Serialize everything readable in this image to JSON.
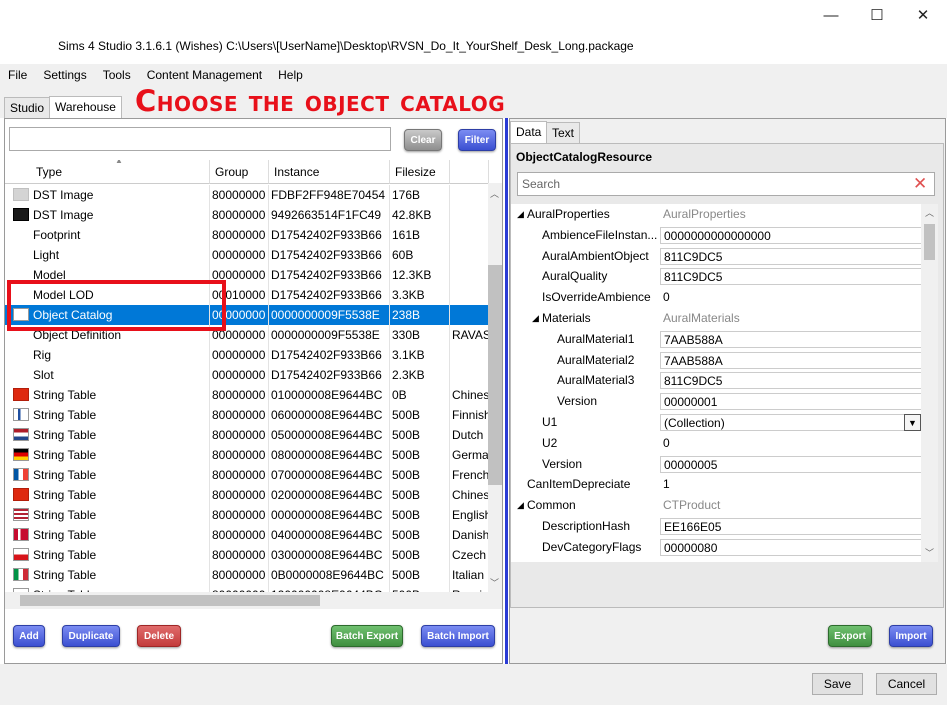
{
  "window": {
    "title": "Sims 4 Studio 3.1.6.1 (Wishes)  C:\\Users\\[UserName]\\Desktop\\RVSN_Do_It_YourShelf_Desk_Long.package",
    "minimize": "—",
    "maximize": "☐",
    "close": "✕"
  },
  "menu": [
    "File",
    "Settings",
    "Tools",
    "Content Management",
    "Help"
  ],
  "tabs": {
    "studio": "Studio",
    "warehouse": "Warehouse"
  },
  "headline": "Choose the object catalog",
  "toolbar": {
    "clear": "Clear",
    "filter": "Filter",
    "filter_value": ""
  },
  "grid": {
    "columns": [
      "Type",
      "Group",
      "Instance",
      "Filesize",
      ""
    ],
    "rows": [
      {
        "type": "DST Image",
        "group": "80000000",
        "instance": "FDBF2FF948E70454",
        "size": "176B",
        "extra": "",
        "icon": "gray"
      },
      {
        "type": "DST Image",
        "group": "80000000",
        "instance": "9492663514F1FC49",
        "size": "42.8KB",
        "extra": "",
        "icon": "dark"
      },
      {
        "type": "Footprint",
        "group": "80000000",
        "instance": "D17542402F933B66",
        "size": "161B",
        "extra": "",
        "icon": ""
      },
      {
        "type": "Light",
        "group": "00000000",
        "instance": "D17542402F933B66",
        "size": "60B",
        "extra": "",
        "icon": ""
      },
      {
        "type": "Model",
        "group": "00000000",
        "instance": "D17542402F933B66",
        "size": "12.3KB",
        "extra": "",
        "icon": ""
      },
      {
        "type": "Model LOD",
        "group": "00010000",
        "instance": "D17542402F933B66",
        "size": "3.3KB",
        "extra": "",
        "icon": ""
      },
      {
        "type": "Object Catalog",
        "group": "00000000",
        "instance": "0000000009F5538E",
        "size": "238B",
        "extra": "",
        "icon": "white",
        "selected": true
      },
      {
        "type": "Object Definition",
        "group": "00000000",
        "instance": "0000000009F5538E",
        "size": "330B",
        "extra": "RAVAS",
        "icon": ""
      },
      {
        "type": "Rig",
        "group": "00000000",
        "instance": "D17542402F933B66",
        "size": "3.1KB",
        "extra": "",
        "icon": ""
      },
      {
        "type": "Slot",
        "group": "00000000",
        "instance": "D17542402F933B66",
        "size": "2.3KB",
        "extra": "",
        "icon": ""
      },
      {
        "type": "String Table",
        "group": "80000000",
        "instance": "010000008E9644BC",
        "size": "0B",
        "extra": "Chines",
        "icon": "cn"
      },
      {
        "type": "String Table",
        "group": "80000000",
        "instance": "060000008E9644BC",
        "size": "500B",
        "extra": "Finnish",
        "icon": "fi"
      },
      {
        "type": "String Table",
        "group": "80000000",
        "instance": "050000008E9644BC",
        "size": "500B",
        "extra": "Dutch",
        "icon": "nl"
      },
      {
        "type": "String Table",
        "group": "80000000",
        "instance": "080000008E9644BC",
        "size": "500B",
        "extra": "Germa",
        "icon": "de"
      },
      {
        "type": "String Table",
        "group": "80000000",
        "instance": "070000008E9644BC",
        "size": "500B",
        "extra": "French",
        "icon": "fr"
      },
      {
        "type": "String Table",
        "group": "80000000",
        "instance": "020000008E9644BC",
        "size": "500B",
        "extra": "Chines",
        "icon": "cn"
      },
      {
        "type": "String Table",
        "group": "80000000",
        "instance": "000000008E9644BC",
        "size": "500B",
        "extra": "English",
        "icon": "us"
      },
      {
        "type": "String Table",
        "group": "80000000",
        "instance": "040000008E9644BC",
        "size": "500B",
        "extra": "Danish",
        "icon": "dk"
      },
      {
        "type": "String Table",
        "group": "80000000",
        "instance": "030000008E9644BC",
        "size": "500B",
        "extra": "Czech",
        "icon": "cz"
      },
      {
        "type": "String Table",
        "group": "80000000",
        "instance": "0B0000008E9644BC",
        "size": "500B",
        "extra": "Italian",
        "icon": "it"
      },
      {
        "type": "String Table",
        "group": "80000000",
        "instance": "120000008E9644BC",
        "size": "500B",
        "extra": "Russia",
        "icon": "ru"
      }
    ]
  },
  "left_buttons": {
    "add": "Add",
    "duplicate": "Duplicate",
    "delete": "Delete",
    "batch_export": "Batch Export",
    "batch_import": "Batch Import"
  },
  "right_tabs": {
    "data": "Data",
    "text": "Text"
  },
  "resource_title": "ObjectCatalogResource",
  "search_placeholder": "Search",
  "properties": [
    {
      "name": "AuralProperties",
      "value": "AuralProperties",
      "level": 0,
      "expander": true,
      "category": true
    },
    {
      "name": "AmbienceFileInstan...",
      "value": "0000000000000000",
      "level": 1
    },
    {
      "name": "AuralAmbientObject",
      "value": "811C9DC5",
      "level": 1
    },
    {
      "name": "AuralQuality",
      "value": "811C9DC5",
      "level": 1
    },
    {
      "name": "IsOverrideAmbience",
      "value": "0",
      "level": 1,
      "plain": true
    },
    {
      "name": "Materials",
      "value": "AuralMaterials",
      "level": 1,
      "expander": true,
      "category": true
    },
    {
      "name": "AuralMaterial1",
      "value": "7AAB588A",
      "level": 2
    },
    {
      "name": "AuralMaterial2",
      "value": "7AAB588A",
      "level": 2
    },
    {
      "name": "AuralMaterial3",
      "value": "811C9DC5",
      "level": 2
    },
    {
      "name": "Version",
      "value": "00000001",
      "level": 2
    },
    {
      "name": "U1",
      "value": "(Collection)",
      "level": 1,
      "dropdown": true
    },
    {
      "name": "U2",
      "value": "0",
      "level": 1,
      "plain": true
    },
    {
      "name": "Version",
      "value": "00000005",
      "level": 1
    },
    {
      "name": "CanItemDepreciate",
      "value": "1",
      "level": 0,
      "plain": true
    },
    {
      "name": "Common",
      "value": "CTProduct",
      "level": 0,
      "expander": true,
      "category": true
    },
    {
      "name": "DescriptionHash",
      "value": "EE166E05",
      "level": 1
    },
    {
      "name": "DevCategoryFlags",
      "value": "00000080",
      "level": 1
    }
  ],
  "right_buttons": {
    "export": "Export",
    "import": "Import"
  },
  "footer": {
    "save": "Save",
    "cancel": "Cancel"
  },
  "colors": {
    "selection": "#0078d7",
    "highlight": "#e8101a",
    "splitter": "#2a3bd4"
  }
}
